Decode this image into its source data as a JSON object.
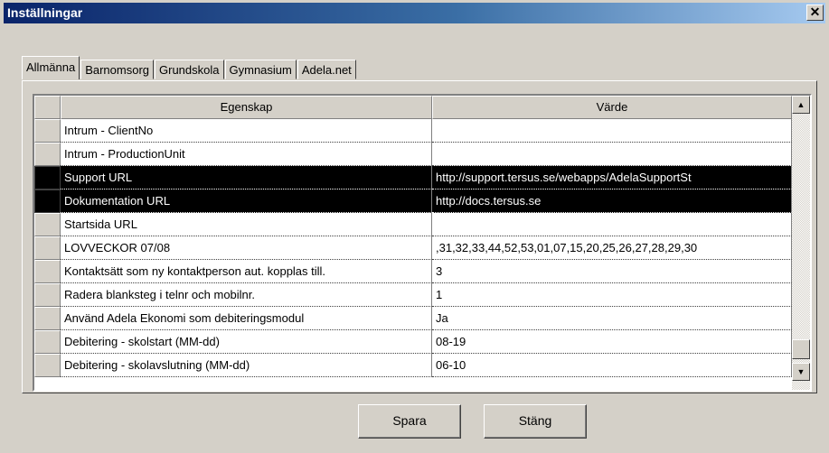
{
  "window": {
    "title": "Inställningar",
    "close_glyph": "✕"
  },
  "tabs": [
    {
      "label": "Allmänna",
      "active": true
    },
    {
      "label": "Barnomsorg"
    },
    {
      "label": "Grundskola"
    },
    {
      "label": "Gymnasium"
    },
    {
      "label": "Adela.net"
    }
  ],
  "grid": {
    "columns": [
      "Egenskap",
      "Värde"
    ],
    "rows": [
      {
        "property": "Intrum - ClientNo",
        "value": ""
      },
      {
        "property": "Intrum - ProductionUnit",
        "value": ""
      },
      {
        "property": "Support URL",
        "value": "http://support.tersus.se/webapps/AdelaSupportSt",
        "selected": true
      },
      {
        "property": "Dokumentation URL",
        "value": "http://docs.tersus.se",
        "selected": true
      },
      {
        "property": "Startsida URL",
        "value": ""
      },
      {
        "property": "LOVVECKOR 07/08",
        "value": ",31,32,33,44,52,53,01,07,15,20,25,26,27,28,29,30"
      },
      {
        "property": "Kontaktsätt som ny kontaktperson aut. kopplas till.",
        "value": "3"
      },
      {
        "property": "Radera blanksteg i telnr och mobilnr.",
        "value": "1"
      },
      {
        "property": "Använd Adela Ekonomi som debiteringsmodul",
        "value": "Ja"
      },
      {
        "property": "Debitering - skolstart (MM-dd)",
        "value": "08-19"
      },
      {
        "property": "Debitering - skolavslutning (MM-dd)",
        "value": "06-10"
      }
    ]
  },
  "buttons": {
    "save": "Spara",
    "close": "Stäng"
  },
  "icons": {
    "scroll_up": "scroll-up-arrow-icon",
    "scroll_down": "scroll-down-arrow-icon"
  }
}
